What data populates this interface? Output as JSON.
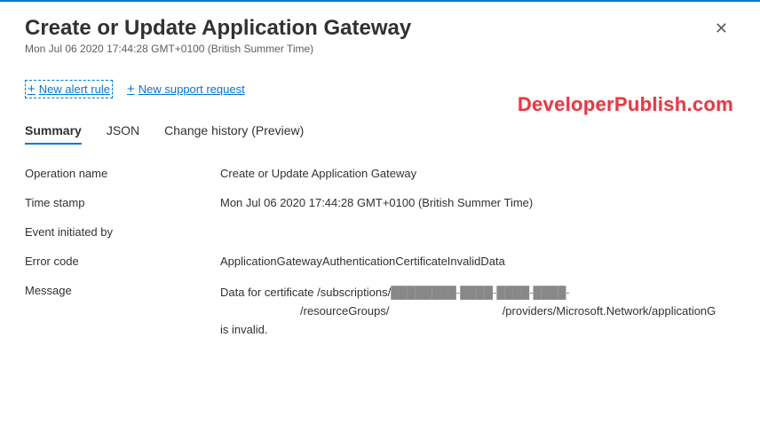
{
  "header": {
    "title": "Create or Update Application Gateway",
    "subtitle": "Mon Jul 06 2020 17:44:28 GMT+0100 (British Summer Time)"
  },
  "actions": {
    "new_alert_rule": "New alert rule",
    "new_support_request": "New support request"
  },
  "tabs": {
    "summary": "Summary",
    "json": "JSON",
    "change_history": "Change history (Preview)"
  },
  "details": {
    "operation_name": {
      "label": "Operation name",
      "value": "Create or Update Application Gateway"
    },
    "time_stamp": {
      "label": "Time stamp",
      "value": "Mon Jul 06 2020 17:44:28 GMT+0100 (British Summer Time)"
    },
    "event_initiated_by": {
      "label": "Event initiated by",
      "value": ""
    },
    "error_code": {
      "label": "Error code",
      "value": "ApplicationGatewayAuthenticationCertificateInvalidData"
    },
    "message": {
      "label": "Message",
      "line1": "Data for certificate /subscriptions/",
      "line1_redacted": "████████-████-████-████-",
      "line2_prefix": "/resourceGroups/",
      "line2_suffix": "/providers/Microsoft.Network/applicationG",
      "line3": "is invalid."
    }
  },
  "watermark": "DeveloperPublish.com"
}
